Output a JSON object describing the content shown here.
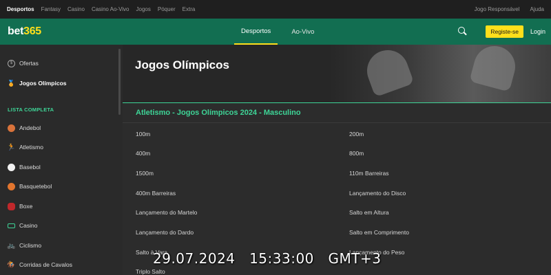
{
  "topbar": {
    "items": [
      "Desportos",
      "Fantasy",
      "Casino",
      "Casino Ao-Vivo",
      "Jogos",
      "Póquer",
      "Extra"
    ],
    "right": [
      "Jogo Responsável",
      "Ajuda"
    ]
  },
  "header": {
    "logo_main": "bet",
    "logo_accent": "365",
    "nav": [
      "Desportos",
      "Ao-Vivo"
    ],
    "register_label": "Registe-se",
    "login_label": "Login"
  },
  "sidebar": {
    "top_items": [
      "Ofertas",
      "Jogos Olímpicos"
    ],
    "section_label": "LISTA COMPLETA",
    "sports": [
      "Andebol",
      "Atletismo",
      "Basebol",
      "Basquetebol",
      "Boxe",
      "Casino",
      "Ciclismo",
      "Corridas de Cavalos"
    ]
  },
  "main": {
    "title": "Jogos Olímpicos",
    "section_title": "Atletismo - Jogos Olímpicos 2024 - Masculino",
    "events_left": [
      "100m",
      "400m",
      "1500m",
      "400m Barreiras",
      "Lançamento do Martelo",
      "Lançamento do Dardo",
      "Salto à Vara",
      "Triplo Salto"
    ],
    "events_right": [
      "200m",
      "800m",
      "110m Barreiras",
      "Lançamento do Disco",
      "Salto em Altura",
      "Salto em Comprimento",
      "Lançamento do Peso"
    ]
  },
  "overlay": {
    "timestamp": "29.07.2024   15:33:00   GMT+3"
  },
  "colors": {
    "brand_green": "#126e51",
    "accent_yellow": "#ffdf1b",
    "accent_green_text": "#3ed597"
  }
}
